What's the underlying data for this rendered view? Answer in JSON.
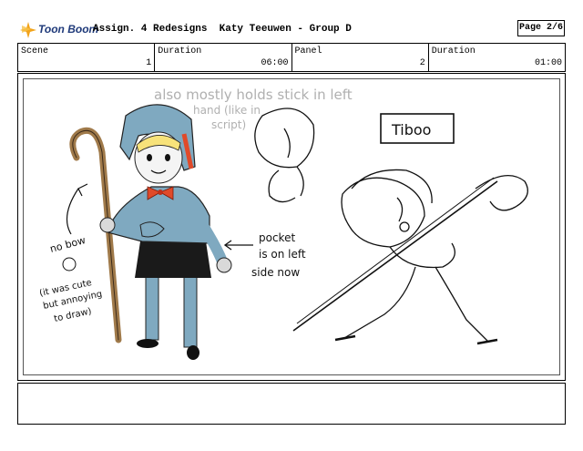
{
  "header": {
    "logo_text": "Toon Boom",
    "title": "Assign. 4 Redesigns  Katy Teeuwen - Group D",
    "page": "Page 2/6"
  },
  "info": {
    "scene_label": "Scene",
    "scene_value": "1",
    "duration_label": "Duration",
    "duration_value": "06:00",
    "panel_label": "Panel",
    "panel_value": "2",
    "duration2_label": "Duration",
    "duration2_value": "01:00"
  },
  "drawing": {
    "note_top_line1": "also mostly holds stick in left",
    "note_top_line2": "hand (like in",
    "note_top_line3": "script)",
    "title_box": "Tiboo",
    "note_bow": "no bow",
    "note_cute_line1": "(it was cute",
    "note_cute_line2": "but annoying",
    "note_cute_line3": "to draw)",
    "note_pocket_line1": "pocket",
    "note_pocket_line2": "is on left",
    "note_pocket_line3": "side now"
  },
  "colors": {
    "bonnet": "#7fa9c0",
    "hair": "#f7e27a",
    "staff": "#a07a4a",
    "bow": "#e04a2a",
    "dress": "#7fa9c0",
    "logo_accent": "#f2a31a"
  }
}
